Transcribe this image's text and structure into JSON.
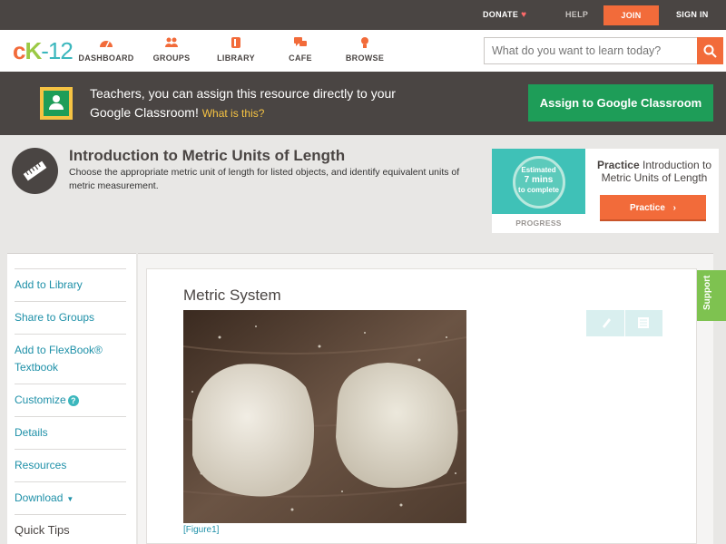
{
  "topbar": {
    "donate": "DONATE",
    "help": "HELP",
    "join": "JOIN",
    "signin": "SIGN IN"
  },
  "logo": {
    "c": "c",
    "k": "K",
    "rest": "-12"
  },
  "nav": {
    "items": [
      {
        "label": "DASHBOARD",
        "icon": "dashboard-icon"
      },
      {
        "label": "GROUPS",
        "icon": "groups-icon"
      },
      {
        "label": "LIBRARY",
        "icon": "library-icon"
      },
      {
        "label": "CAFE",
        "icon": "cafe-icon"
      },
      {
        "label": "BROWSE",
        "icon": "browse-icon"
      }
    ],
    "search_placeholder": "What do you want to learn today?"
  },
  "banner": {
    "text": "Teachers, you can assign this resource directly to your Google Classroom!",
    "what_link": "What is this?",
    "assign_button": "Assign to Google Classroom"
  },
  "lesson": {
    "title": "Introduction to Metric Units of Length",
    "description": "Choose the appropriate metric unit of length for listed objects, and identify equivalent units of metric measurement."
  },
  "practice": {
    "estimate_line1": "Estimated",
    "estimate_line2": "7 mins",
    "estimate_line3": "to complete",
    "progress_label": "PROGRESS",
    "heading_bold": "Practice",
    "heading_rest": " Introduction to Metric Units of Length",
    "button": "Practice"
  },
  "sidebar": {
    "items": [
      {
        "label": "Add to Library"
      },
      {
        "label": "Share to Groups"
      },
      {
        "label": "Add to FlexBook® Textbook"
      },
      {
        "label": "Customize"
      },
      {
        "label": "Details"
      },
      {
        "label": "Resources"
      },
      {
        "label": "Download"
      }
    ],
    "quick_tips": "Quick Tips"
  },
  "content": {
    "section_title": "Metric System",
    "figure_caption": "[Figure1]"
  },
  "support": "Support",
  "colors": {
    "accent": "#f26b3a",
    "google_green": "#1e9d58",
    "dark": "#4a4543",
    "teal": "#3fc1b7",
    "link": "#1e90a8",
    "support_green": "#7ec250"
  }
}
